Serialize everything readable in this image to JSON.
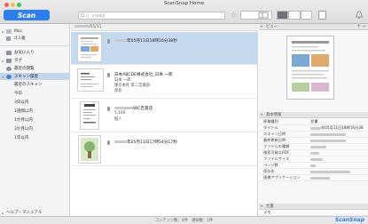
{
  "window": {
    "title": "ScanSnap Home"
  },
  "toolbar": {
    "scan_label": "Scan",
    "search_placeholder": "Q- 全体検索",
    "star_glyph": "☆"
  },
  "sidebar": {
    "items": [
      {
        "label": "Mac",
        "icon": "computer-icon"
      },
      {
        "label": "ゴミ箱",
        "icon": "trash-icon"
      },
      {
        "label": "お気に入り",
        "icon": "favorites-icon"
      },
      {
        "label": "タグ",
        "icon": "tag-icon"
      },
      {
        "label": "最近の閲覧",
        "icon": "recent-icon"
      },
      {
        "label": "スキャン履歴",
        "icon": "scan-history-icon"
      }
    ],
    "sub_items": [
      "最近のスキャン",
      "今日",
      "3日以内",
      "1週間以内",
      "1か月以内",
      "3か月以内",
      "1年以内"
    ],
    "help_label": "ヘルプ・マニュアル"
  },
  "list": {
    "header_suffix": "/05/11",
    "rows": [
      {
        "title": "年05月11日18時16分38秒",
        "sub": ""
      },
      {
        "title": "日本ABCDE株式会社_日本 一郎",
        "lines": [
          "日本 一郎",
          "東京本社 第二営業部",
          "部長"
        ]
      },
      {
        "title": "ABC百貨店",
        "lines": [
          "5,160",
          "個人"
        ]
      },
      {
        "title": "年05月11日17時54分17秒",
        "lines": []
      }
    ]
  },
  "right": {
    "preview_title": "ビュー",
    "plus": "+",
    "minus": "−",
    "info_title": "基本情報",
    "props": [
      {
        "key": "原稿種別",
        "value": "文書"
      },
      {
        "key": "タイトル",
        "value": "年05月11日18時16分38"
      },
      {
        "key": "スキャン日時",
        "value": ""
      },
      {
        "key": "最終更新日時",
        "value": ""
      },
      {
        "key": "ファイルの種類",
        "value": ""
      },
      {
        "key": "検索可能なPDF",
        "value": ""
      },
      {
        "key": "ファイルサイズ",
        "value": ""
      },
      {
        "key": "ページ数",
        "value": ""
      },
      {
        "key": "保存先",
        "value": ""
      },
      {
        "key": "連携アプリケーション",
        "value": ""
      }
    ],
    "memo_title": "文書",
    "memo_label": "メモ"
  },
  "status": {
    "message": "コンテンツ数：4件　選択数：1件",
    "brand": "ScanSnap"
  },
  "colors": {
    "accent": "#2d7ef0",
    "selection": "#c5d9ef"
  }
}
